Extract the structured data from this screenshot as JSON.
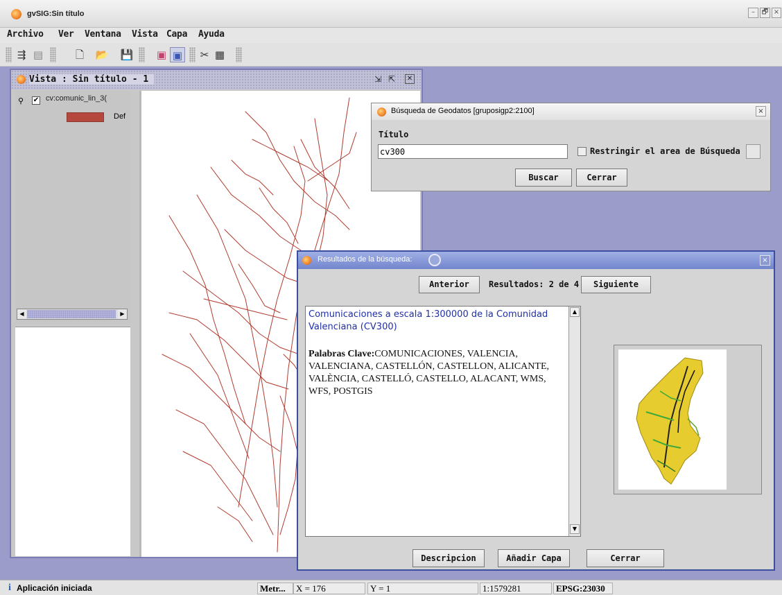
{
  "app": {
    "title": "gvSIG:Sin título"
  },
  "window_controls": {
    "minimize": "–",
    "maximize": "🗗",
    "close": "×"
  },
  "menu": [
    "Archivo",
    "Ver",
    "Ventana",
    "Vista",
    "Capa",
    "Ayuda"
  ],
  "toolbar": {
    "icons": [
      "layers-icon",
      "catalog-icon",
      "new-document-icon",
      "open-folder-icon",
      "save-icon",
      "preview-icon",
      "print-preview-icon",
      "tools-icon",
      "grid-icon"
    ]
  },
  "view_window": {
    "title": "Vista : Sin título - 1",
    "layer_name": "cv:comunic_lin_3(",
    "legend_label": "Def",
    "legend_color": "#b5473d",
    "map_line_color": "#b03a2e"
  },
  "search_dialog": {
    "title": "Búsqueda de Geodatos  [gruposigp2:2100]",
    "field_label": "Título",
    "field_value": "cv300",
    "restrict_label": "Restringir el area de Búsqueda",
    "search_button": "Buscar",
    "close_button": "Cerrar"
  },
  "results_dialog": {
    "title": "Resultados de la búsqueda:",
    "prev_button": "Anterior",
    "results_label": "Resultados: 2 de 4",
    "next_button": "Siguiente",
    "description_title": "Comunicaciones a escala 1:300000 de la Comunidad Valenciana (CV300)",
    "keywords_label": "Palabras Clave:",
    "keywords": "COMUNICACIONES, VALENCIA, VALENCIANA, CASTELLÓN, CASTELLON, ALICANTE, VALÈNCIA, CASTELLÓ, CASTELLO, ALACANT, WMS, WFS, POSTGIS",
    "description_button": "Descripcion",
    "add_layer_button": "Añadir Capa",
    "close_button": "Cerrar"
  },
  "status_bar": {
    "message": "Aplicación iniciada",
    "units": "Metr...",
    "x": "X = 176",
    "y": "Y = 1",
    "scale": "1:1579281",
    "crs": "EPSG:23030"
  }
}
